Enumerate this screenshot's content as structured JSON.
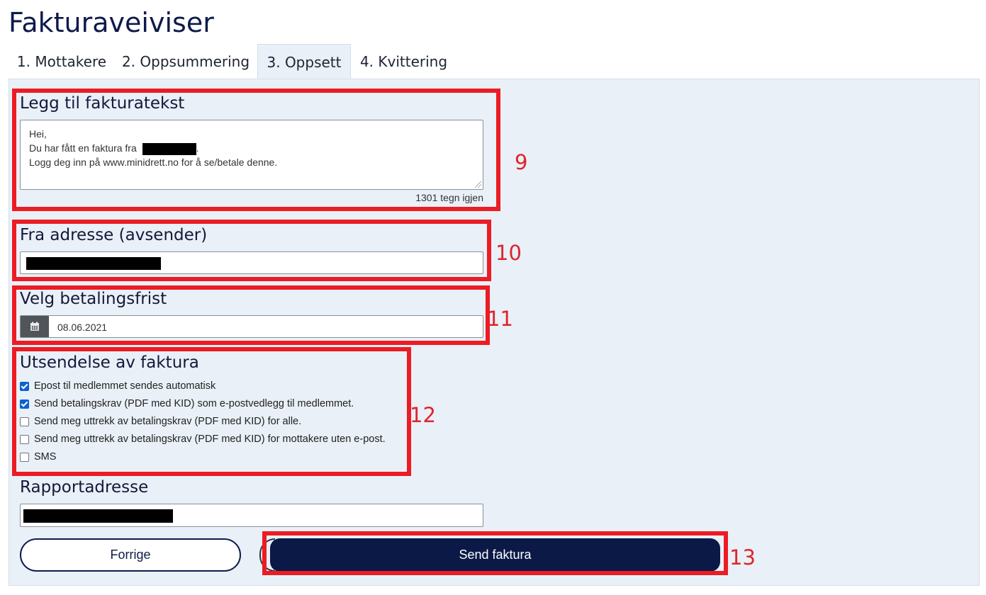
{
  "page": {
    "title": "Fakturaveiviser"
  },
  "tabs": [
    {
      "label": "1. Mottakere"
    },
    {
      "label": "2. Oppsummering"
    },
    {
      "label": "3. Oppsett"
    },
    {
      "label": "4. Kvittering"
    }
  ],
  "invoice_text": {
    "heading": "Legg til fakturatekst",
    "line1": "Hei,",
    "line2": "Du har fått en faktura fra",
    "line2_suffix": ".",
    "line3": "Logg deg inn på www.minidrett.no for å se/betale denne.",
    "counter": "1301 tegn igjen"
  },
  "from_address": {
    "heading": "Fra adresse (avsender)"
  },
  "due_date": {
    "heading": "Velg betalingsfrist",
    "value": "08.06.2021"
  },
  "delivery": {
    "heading": "Utsendelse av faktura",
    "options": [
      {
        "label": "Epost til medlemmet sendes automatisk",
        "checked": true
      },
      {
        "label": "Send betalingskrav (PDF med KID) som e-postvedlegg til medlemmet.",
        "checked": true
      },
      {
        "label": "Send meg uttrekk av betalingskrav (PDF med KID) for alle.",
        "checked": false
      },
      {
        "label": "Send meg uttrekk av betalingskrav (PDF med KID) for mottakere uten e-post.",
        "checked": false
      },
      {
        "label": "SMS",
        "checked": false
      }
    ]
  },
  "report_address": {
    "heading": "Rapportadresse"
  },
  "buttons": {
    "previous": "Forrige",
    "send": "Send faktura"
  },
  "annotations": [
    "9",
    "10",
    "11",
    "12",
    "13"
  ],
  "colors": {
    "highlight": "#ec1c24",
    "primary": "#0b1947",
    "panel": "#e9f0f7",
    "checkbox": "#0a63d1"
  }
}
